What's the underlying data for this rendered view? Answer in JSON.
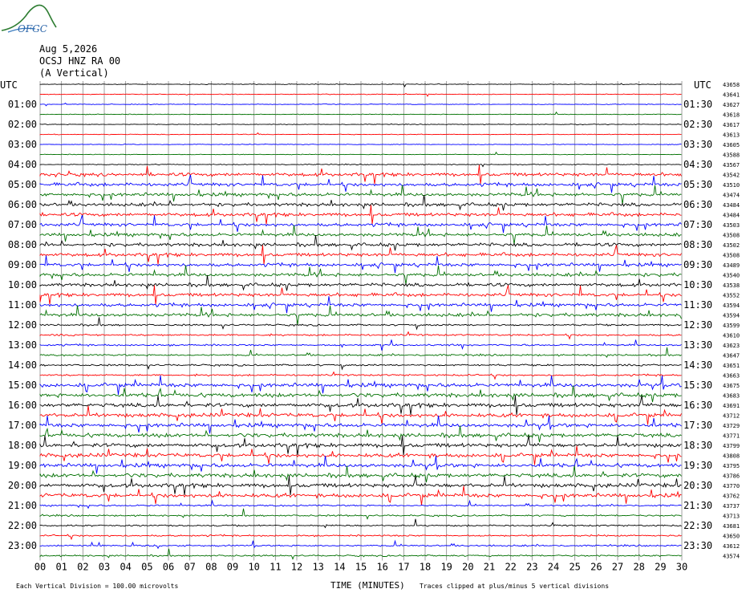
{
  "logo": {
    "text": "OFGC"
  },
  "header": {
    "date": "Aug 5,2026",
    "station": "OCSJ HNZ RA 00",
    "component": "(A Vertical)"
  },
  "chart_data": {
    "type": "line",
    "title": "",
    "left_axis_label": "UTC",
    "right_axis_label": "UTC",
    "left_row_labels": [
      "",
      "01:00",
      "02:00",
      "03:00",
      "04:00",
      "05:00",
      "06:00",
      "07:00",
      "08:00",
      "09:00",
      "10:00",
      "11:00",
      "12:00",
      "13:00",
      "14:00",
      "15:00",
      "16:00",
      "17:00",
      "18:00",
      "19:00",
      "20:00",
      "21:00",
      "22:00",
      "23:00"
    ],
    "right_row_labels": [
      "",
      "01:30",
      "02:30",
      "03:30",
      "04:30",
      "05:30",
      "06:30",
      "07:30",
      "08:30",
      "09:30",
      "10:30",
      "11:30",
      "12:30",
      "13:30",
      "14:30",
      "15:30",
      "16:30",
      "17:30",
      "18:30",
      "19:30",
      "20:30",
      "21:30",
      "22:30",
      "23:30"
    ],
    "trace_offsets": [
      43658,
      43641,
      43627,
      43618,
      43617,
      43613,
      43605,
      43588,
      43567,
      43542,
      43510,
      43474,
      43484,
      43484,
      43503,
      43508,
      43502,
      43508,
      43489,
      43540,
      43538,
      43552,
      43594,
      43594,
      43599,
      43610,
      43623,
      43647,
      43651,
      43663,
      43675,
      43683,
      43691,
      43712,
      43729,
      43771,
      43799,
      43808,
      43795,
      43786,
      43770,
      43762,
      43737,
      43713,
      43681,
      43650,
      43612,
      43574
    ],
    "trace_colors": [
      "#000000",
      "#ff0000",
      "#0000ff",
      "#007000"
    ],
    "x_ticks": [
      "00",
      "01",
      "02",
      "03",
      "04",
      "05",
      "06",
      "07",
      "08",
      "09",
      "10",
      "11",
      "12",
      "13",
      "14",
      "15",
      "16",
      "17",
      "18",
      "19",
      "20",
      "21",
      "22",
      "23",
      "24",
      "25",
      "26",
      "27",
      "28",
      "29",
      "30"
    ],
    "xlabel": "TIME (MINUTES)",
    "xlim": [
      0,
      30
    ],
    "minutes_per_trace": 30,
    "trace_count": 48,
    "grid": true,
    "footer_left": "Each Vertical Division =  100.00 microvolts",
    "footer_right": "Traces clipped at plus/minus 5 vertical divisions"
  }
}
